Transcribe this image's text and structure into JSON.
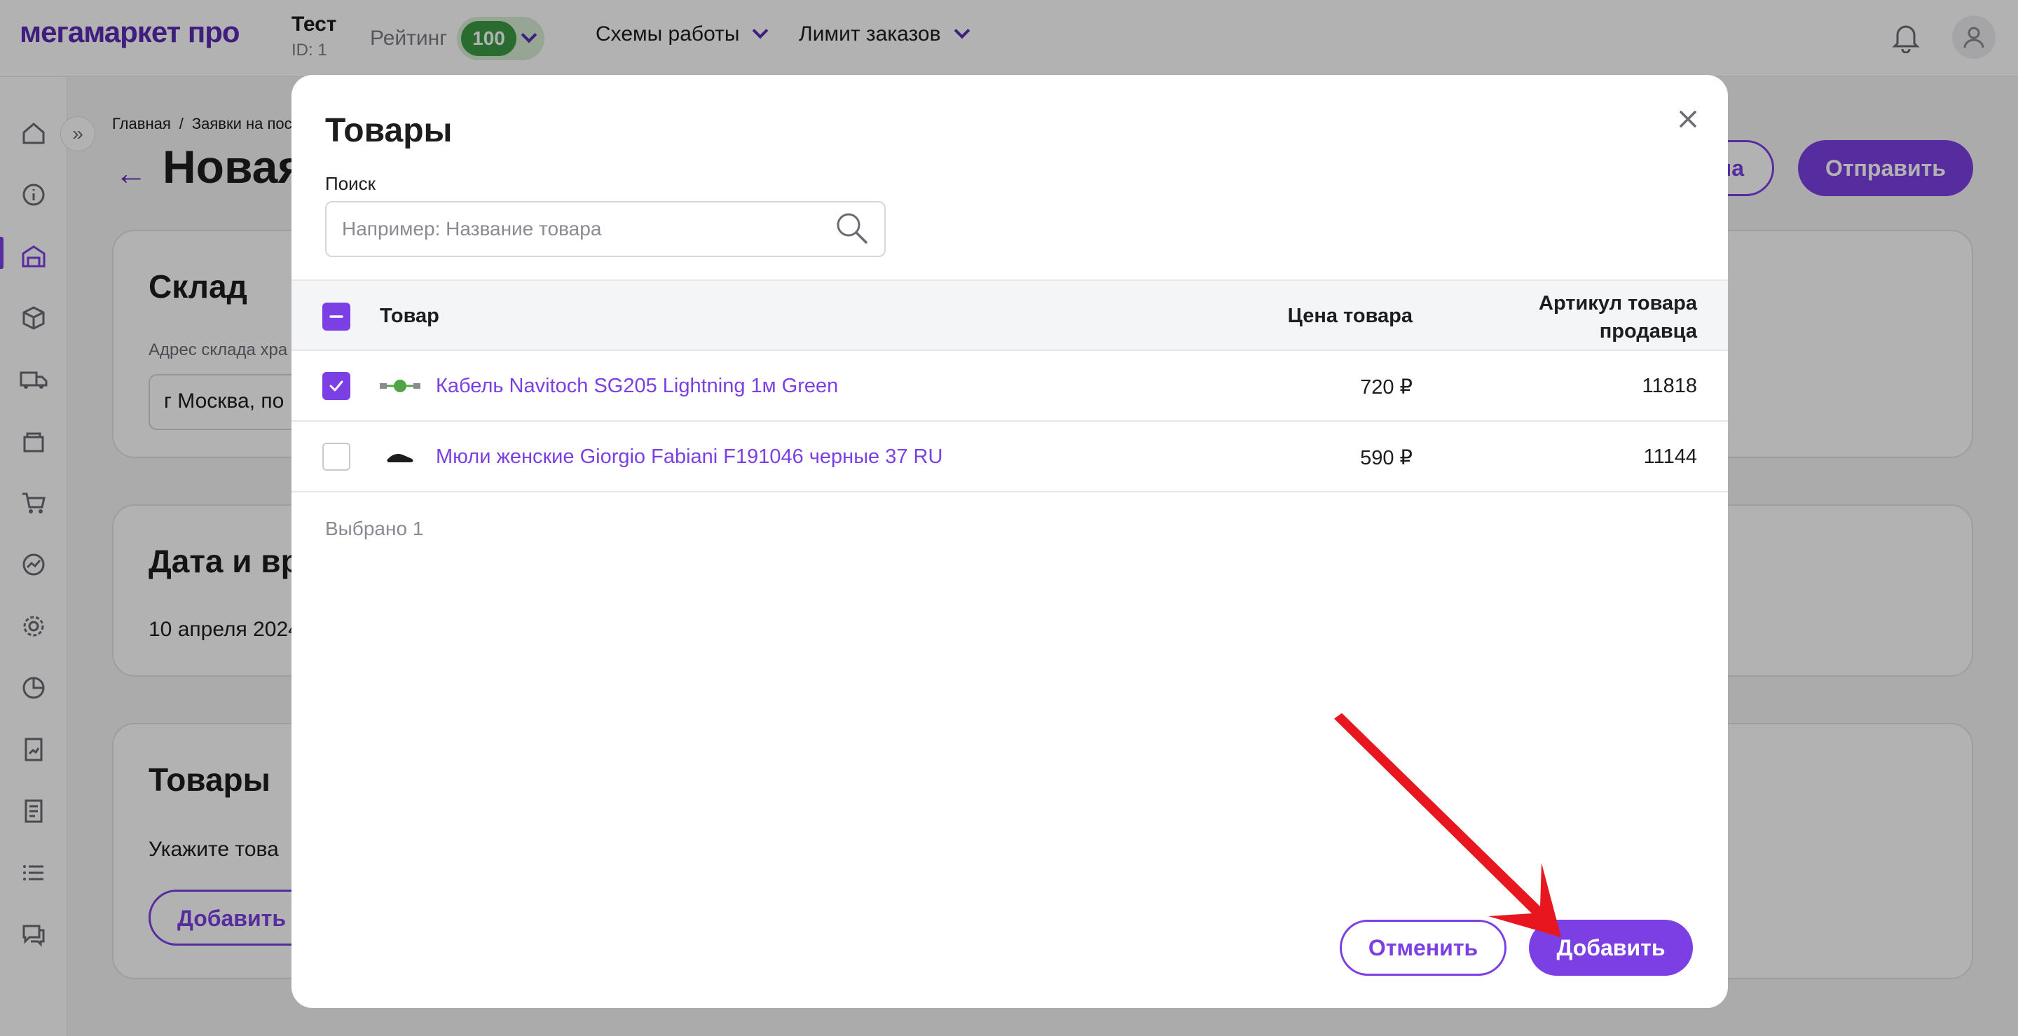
{
  "topbar": {
    "logo": "мегамаркет про",
    "account_name": "Тест",
    "account_id": "ID: 1",
    "rating_label": "Рейтинг",
    "rating_value": "100",
    "menu_schemes": "Схемы работы",
    "menu_limit": "Лимит заказов"
  },
  "page": {
    "breadcrumb_home": "Главная",
    "breadcrumb_sep": "/",
    "breadcrumb_current": "Заявки на пос",
    "title": "Новая",
    "btn_partial": "на",
    "btn_send": "Отправить",
    "warehouse_title": "Склад",
    "warehouse_label": "Адрес склада хра",
    "warehouse_value": "г Москва, по",
    "date_title": "Дата и вр",
    "date_value": "10 апреля 2024",
    "goods_title": "Товары",
    "goods_hint": "Укажите това",
    "goods_add_btn": "Добавить т"
  },
  "modal": {
    "title": "Товары",
    "search_label": "Поиск",
    "search_placeholder": "Например: Название товара",
    "columns": {
      "product": "Товар",
      "price": "Цена товара",
      "sku_line1": "Артикул товара",
      "sku_line2": "продавца"
    },
    "rows": [
      {
        "name": "Кабель Navitoch SG205 Lightning 1м Green",
        "price": "720 ₽",
        "sku": "11818",
        "checked": true
      },
      {
        "name": "Мюли женские Giorgio Fabiani F191046 черные 37 RU",
        "price": "590 ₽",
        "sku": "11144",
        "checked": false
      }
    ],
    "selected_count": "Выбрано 1",
    "cancel_label": "Отменить",
    "add_label": "Добавить"
  },
  "colors": {
    "accent": "#7b3fe4",
    "logo": "#5b2bb5",
    "rating_green": "#3d9a45",
    "annotation_arrow": "#e8161f"
  },
  "icons": [
    "bell-icon",
    "user-icon",
    "home-icon",
    "info-icon",
    "warehouse-icon",
    "box-icon",
    "truck-icon",
    "store-icon",
    "cart-icon",
    "chart-icon",
    "gear-icon",
    "pie-icon",
    "report-icon",
    "document-icon",
    "list-icon",
    "chat-icon",
    "search-icon",
    "close-icon",
    "check-icon",
    "minus-icon"
  ]
}
